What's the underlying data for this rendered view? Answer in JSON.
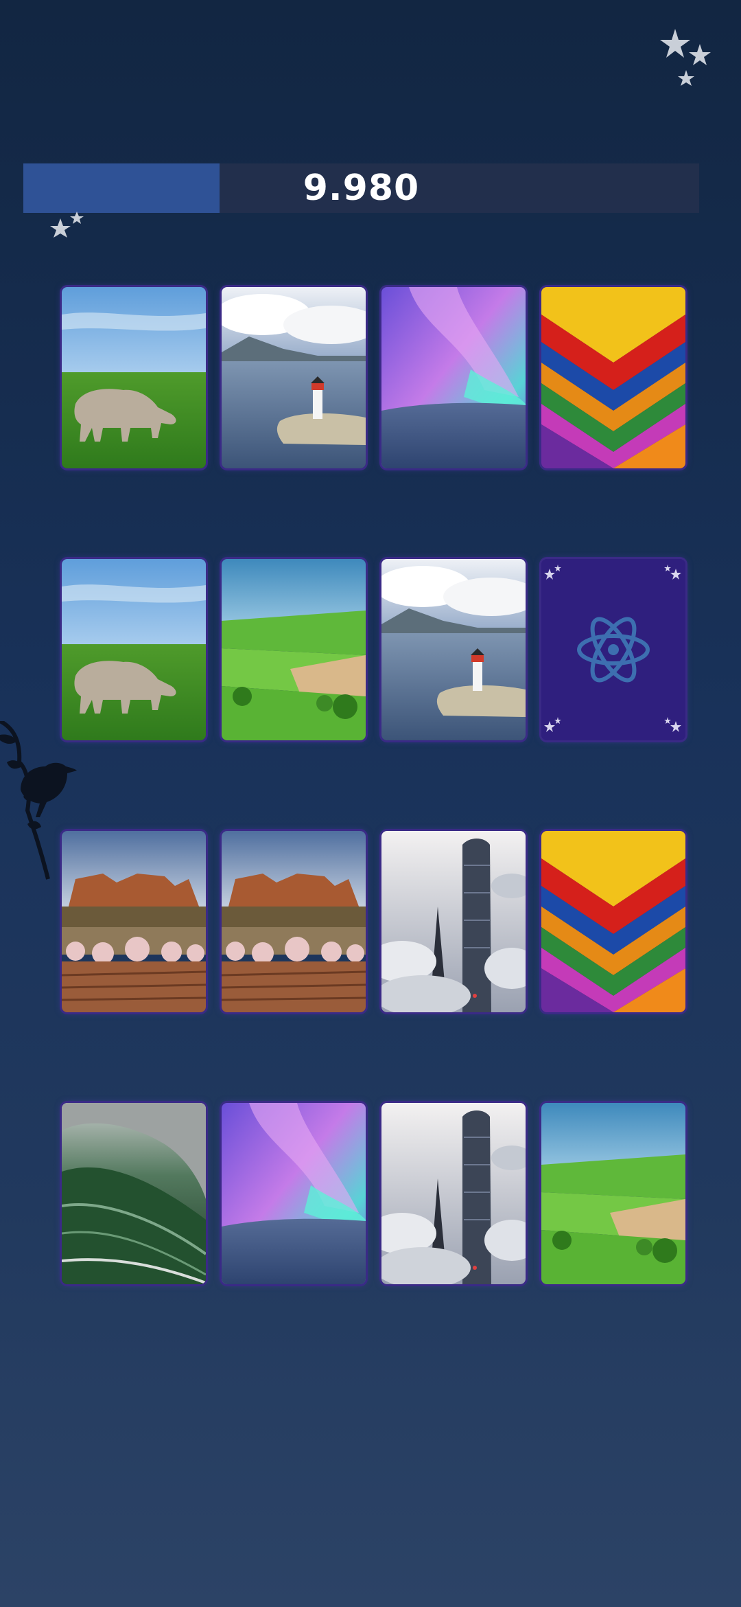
{
  "game": {
    "score": "9.980",
    "time_progress": 0.29
  },
  "cards": [
    {
      "image": "rhino",
      "face_up": true
    },
    {
      "image": "lighthouse",
      "face_up": true
    },
    {
      "image": "aurora",
      "face_up": true
    },
    {
      "image": "chevron-abstract",
      "face_up": true
    },
    {
      "image": "rhino",
      "face_up": true
    },
    {
      "image": "green-fields",
      "face_up": true
    },
    {
      "image": "lighthouse",
      "face_up": true
    },
    {
      "image": "atom-card-back",
      "face_up": false
    },
    {
      "image": "rock-mesa",
      "face_up": true
    },
    {
      "image": "rock-mesa",
      "face_up": true
    },
    {
      "image": "skyscraper-clouds",
      "face_up": true
    },
    {
      "image": "chevron-abstract",
      "face_up": true
    },
    {
      "image": "ocean-wave",
      "face_up": true
    },
    {
      "image": "aurora",
      "face_up": true
    },
    {
      "image": "skyscraper-clouds",
      "face_up": true
    },
    {
      "image": "green-fields",
      "face_up": true
    }
  ],
  "colors": {
    "background_top": "#122642",
    "background_bottom": "#2c4366",
    "progress_fill": "#2f5296",
    "card_border": "#3a2a86",
    "card_back": "#2f1f7e",
    "atom_icon": "#3d6fb0"
  }
}
